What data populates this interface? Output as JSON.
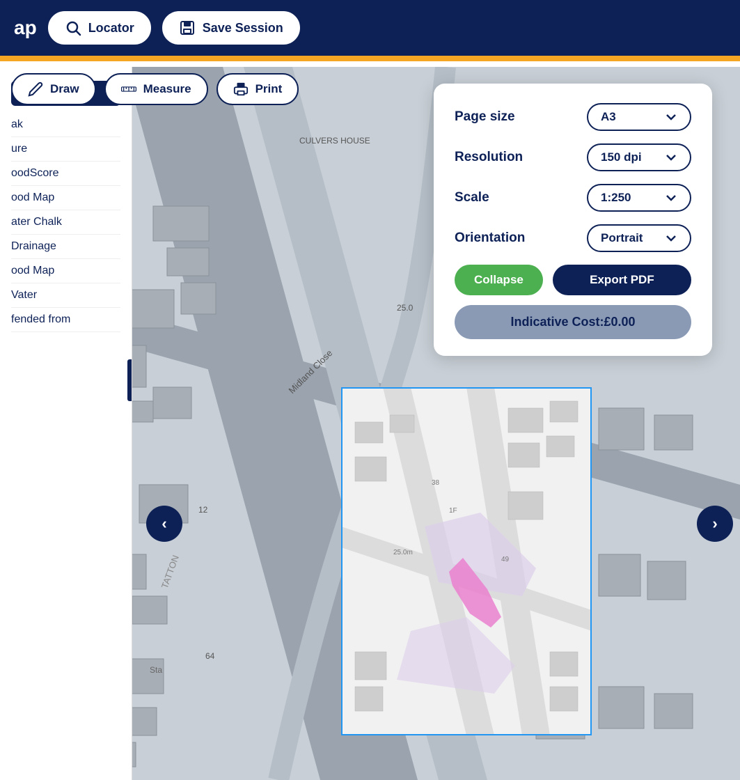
{
  "header": {
    "title": "ap",
    "locator_label": "Locator",
    "save_session_label": "Save Session"
  },
  "toolbar": {
    "draw_label": "Draw",
    "measure_label": "Measure",
    "print_label": "Print"
  },
  "sidebar": {
    "items": [
      {
        "label": "ak"
      },
      {
        "label": "ure"
      },
      {
        "label": "oodScore"
      },
      {
        "label": "ood Map"
      },
      {
        "label": "ater Chalk"
      },
      {
        "label": "Drainage"
      },
      {
        "label": "ood Map"
      },
      {
        "label": "Vater"
      },
      {
        "label": "fended from"
      }
    ]
  },
  "print_panel": {
    "page_size_label": "Page size",
    "page_size_value": "A3",
    "resolution_label": "Resolution",
    "resolution_value": "150 dpi",
    "scale_label": "Scale",
    "scale_value": "1:250",
    "orientation_label": "Orientation",
    "orientation_value": "Portrait",
    "collapse_label": "Collapse",
    "export_label": "Export PDF",
    "indicative_cost_label": "Indicative Cost:£0.00"
  },
  "map": {
    "street_label": "Midland Close",
    "number_25": "25.0",
    "number_38": "38",
    "number_12": "12",
    "number_64": "64"
  }
}
